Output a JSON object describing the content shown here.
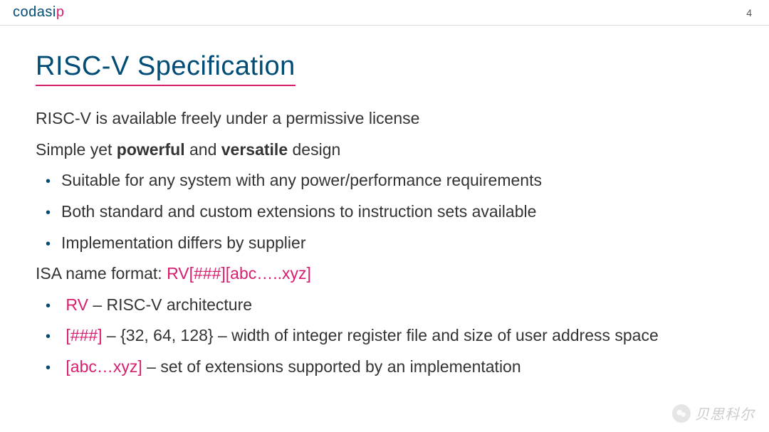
{
  "header": {
    "logo_main": "codasi",
    "logo_accent": "p",
    "page_number": "4"
  },
  "slide": {
    "title": "RISC-V Specification",
    "line1": "RISC-V is available freely under a permissive license",
    "line2_pre": "Simple yet ",
    "line2_b1": "powerful",
    "line2_mid": " and ",
    "line2_b2": "versatile",
    "line2_post": " design",
    "bullets1": [
      "Suitable for any system with any power/performance requirements",
      "Both standard and custom extensions to instruction sets available",
      "Implementation differs by supplier"
    ],
    "isa_line_pre": "ISA name format: ",
    "isa_line_accent": "RV[###][abc…..xyz]",
    "b2_1_accent": "RV",
    "b2_1_rest": " – RISC-V architecture",
    "b2_2_accent": "[###]",
    "b2_2_rest": " – {32, 64, 128} – width of integer register file and size of user address space",
    "b2_3_accent": "[abc…xyz]",
    "b2_3_rest": " – set of extensions supported by an implementation"
  },
  "watermark": {
    "text": "贝思科尔"
  }
}
